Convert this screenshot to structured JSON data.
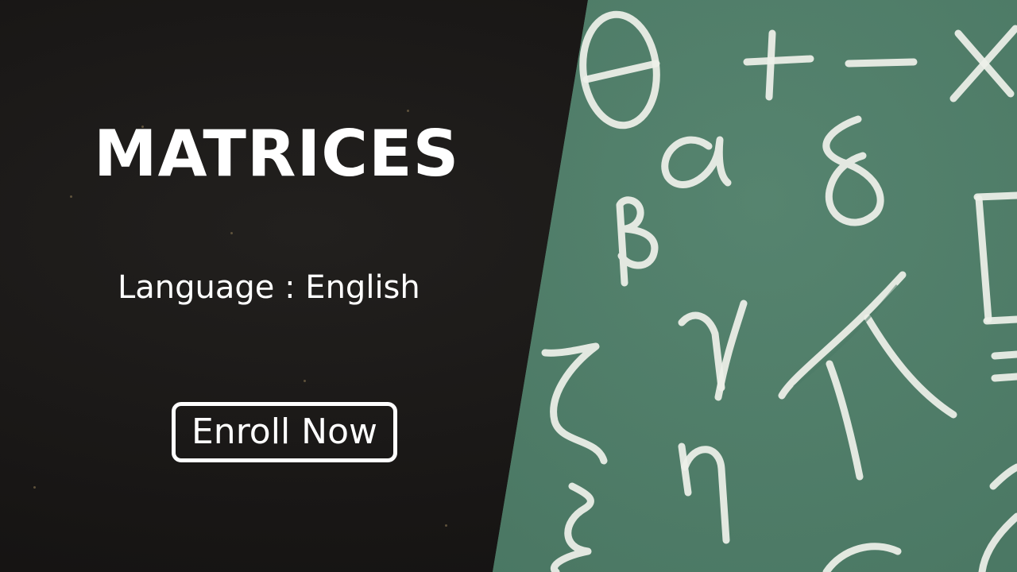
{
  "course": {
    "title": "MATRICES",
    "language": "Language : English",
    "enroll_label": "Enroll Now"
  },
  "decoration": {
    "chalk_symbols": [
      "theta",
      "plus",
      "minus",
      "times",
      "alpha",
      "delta",
      "beta",
      "gamma",
      "pi",
      "zeta",
      "eta",
      "xi"
    ]
  },
  "colors": {
    "dark_panel": "#181615",
    "chalkboard": "#4d7a66",
    "text": "#ffffff"
  }
}
